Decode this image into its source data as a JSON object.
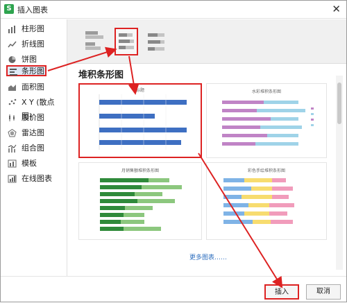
{
  "window": {
    "title": "插入图表",
    "app_icon_letter": "S"
  },
  "sidebar": {
    "items": [
      {
        "label": "柱形图",
        "icon": "column-chart-icon"
      },
      {
        "label": "折线图",
        "icon": "line-chart-icon"
      },
      {
        "label": "饼图",
        "icon": "pie-chart-icon"
      },
      {
        "label": "条形图",
        "icon": "bar-chart-icon"
      },
      {
        "label": "面积图",
        "icon": "area-chart-icon"
      },
      {
        "label": "X Y (散点图)",
        "icon": "scatter-chart-icon"
      },
      {
        "label": "股价图",
        "icon": "stock-chart-icon"
      },
      {
        "label": "雷达图",
        "icon": "radar-chart-icon"
      },
      {
        "label": "组合图",
        "icon": "combo-chart-icon"
      },
      {
        "label": "模板",
        "icon": "template-icon"
      },
      {
        "label": "在线图表",
        "icon": "online-chart-icon"
      }
    ]
  },
  "main": {
    "heading": "堆积条形图",
    "cards": [
      {
        "title": "标题"
      },
      {
        "title": "水彩堆积条形图"
      },
      {
        "title": "月销售额堆积条形图"
      },
      {
        "title": "彩色手绘堆积条形图"
      }
    ],
    "more_link": "更多图表……"
  },
  "footer": {
    "ok_label": "插入",
    "cancel_label": "取消"
  },
  "colors": {
    "accent_red": "#d22222",
    "selection_blue": "#dfe9f6",
    "link_blue": "#2f6fbf",
    "bar_blue": "#3e6fc2",
    "bar_green": "#56a843"
  }
}
